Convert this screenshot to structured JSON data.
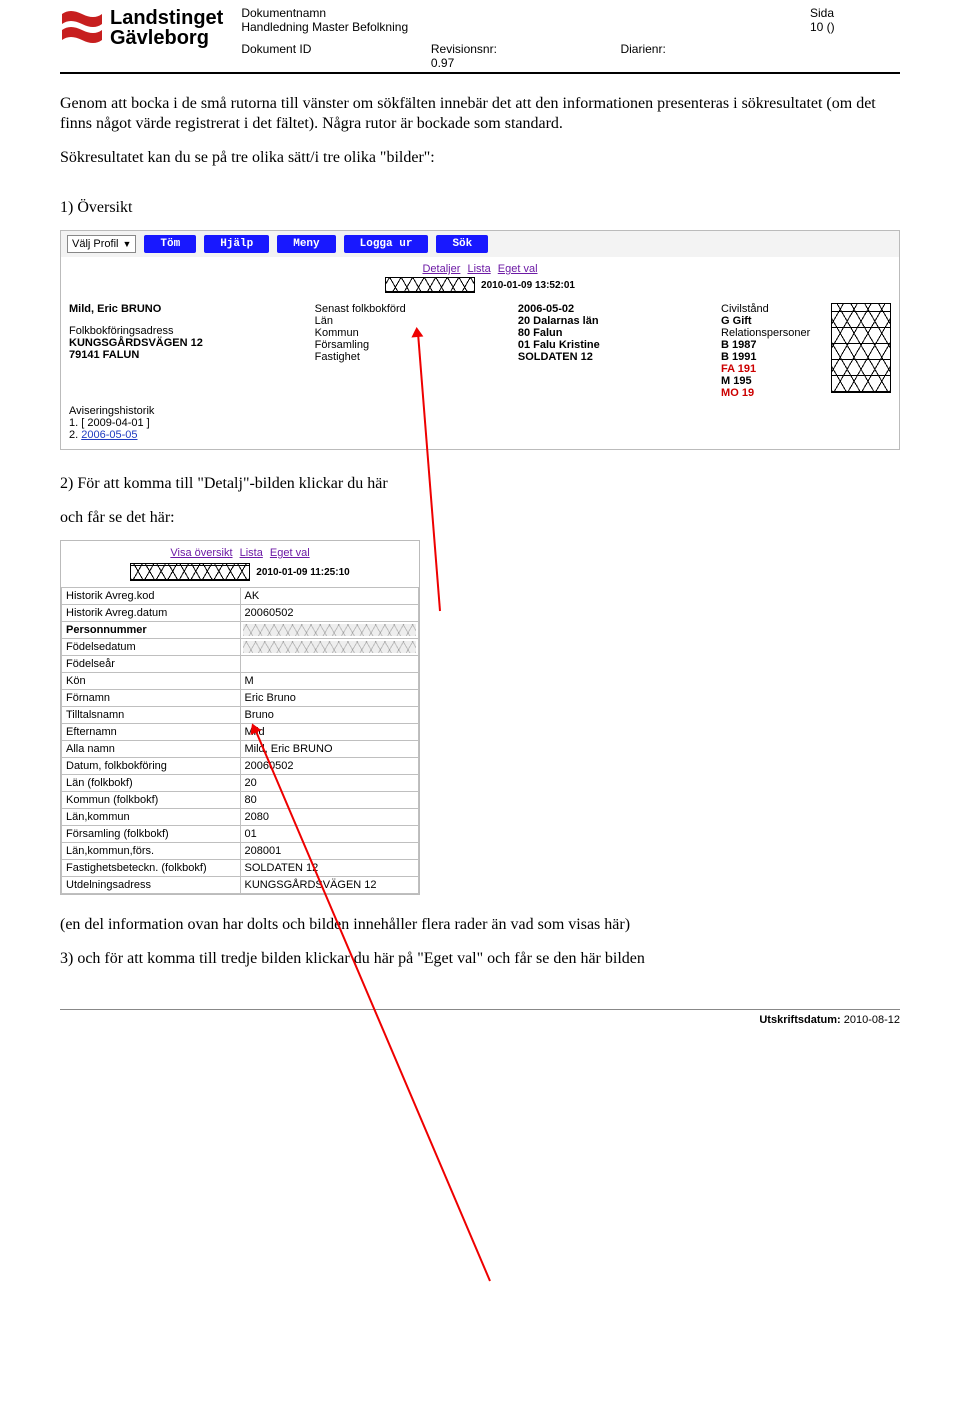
{
  "header": {
    "logo1": "Landstinget",
    "logo2": "Gävleborg",
    "row1": {
      "c1l": "Dokumentnamn",
      "c4l": "Sida"
    },
    "row1v": {
      "c1": "Handledning Master Befolkning",
      "c4": "10 ()"
    },
    "row2": {
      "c1l": "Dokument ID",
      "c2l": "Revisionsnr:",
      "c3l": "Diarienr:"
    },
    "row2v": {
      "c2": "0.97"
    }
  },
  "body": {
    "p1": "Genom att bocka i de små rutorna till vänster om sökfälten innebär det att den informationen presenteras i sökresultatet (om det finns något värde registrerat i det fältet).",
    "p2": "Några rutor är bockade som standard.",
    "p3": "Sökresultatet kan du se på tre olika sätt/i tre olika \"bilder\":",
    "h1": "1) Översikt",
    "p4": "2) För att komma till \"Detalj\"-bilden klickar du här",
    "p5": "och får se det här:",
    "p6": "(en del information ovan har dolts och bilden innehåller flera rader än vad som visas här)",
    "p7": "3) och för att komma till tredje bilden klickar du här på \"Eget val\" och får se den här bilden"
  },
  "shot1": {
    "profile": "Välj Profil",
    "buttons": [
      "Töm",
      "Hjälp",
      "Meny",
      "Logga ur",
      "Sök"
    ],
    "sublinks": [
      "Detaljer",
      "Lista",
      "Eget val"
    ],
    "timestamp": "2010-01-09 13:52:01",
    "col2labels": [
      "Senast folkbokförd",
      "Län",
      "Kommun",
      "Församling",
      "Fastighet"
    ],
    "col3values": [
      "2006-05-02",
      "20 Dalarnas län",
      "80 Falun",
      "01 Falu Kristine",
      "SOLDATEN 12"
    ],
    "col4label": "Civilstånd",
    "col4value": "G Gift",
    "col4label2": "Relationspersoner",
    "rel": [
      "B 1987",
      "B 1991",
      "FA 191",
      "M 195",
      "MO 19"
    ],
    "name": "Mild, Eric BRUNO",
    "addr_label": "Folkbokföringsadress",
    "addr1": "KUNGSGÅRDSVÄGEN 12",
    "addr2": "79141 FALUN",
    "avis_label": "Aviseringshistorik",
    "avis1": "1. [ 2009-04-01 ]",
    "avis2_pre": "2. ",
    "avis2_link": "2006-05-05"
  },
  "shot2": {
    "sublinks": [
      "Visa översikt",
      "Lista",
      "Eget val"
    ],
    "timestamp": "2010-01-09 11:25:10",
    "rows": [
      {
        "label": "Historik Avreg.kod",
        "value": "AK"
      },
      {
        "label": "Historik Avreg.datum",
        "value": "20060502"
      },
      {
        "label": "Personnummer",
        "value": "",
        "strong": true,
        "blur": true
      },
      {
        "label": "Födelsedatum",
        "value": "",
        "blur": true
      },
      {
        "label": "Födelseår",
        "value": ""
      },
      {
        "label": "Kön",
        "value": "M"
      },
      {
        "label": "Förnamn",
        "value": "Eric Bruno"
      },
      {
        "label": "Tilltalsnamn",
        "value": "Bruno"
      },
      {
        "label": "Efternamn",
        "value": "Mild"
      },
      {
        "label": "Alla namn",
        "value": "Mild, Eric BRUNO"
      },
      {
        "label": "Datum, folkbokföring",
        "value": "20060502"
      },
      {
        "label": "Län (folkbokf)",
        "value": "20"
      },
      {
        "label": "Kommun (folkbokf)",
        "value": "80"
      },
      {
        "label": "Län,kommun",
        "value": "2080"
      },
      {
        "label": "Församling (folkbokf)",
        "value": "01"
      },
      {
        "label": "Län,kommun,förs.",
        "value": "208001"
      },
      {
        "label": "Fastighetsbeteckn. (folkbokf)",
        "value": "SOLDATEN 12"
      },
      {
        "label": "Utdelningsadress",
        "value": "KUNGSGÅRDSVÄGEN 12"
      }
    ]
  },
  "footer": {
    "label": "Utskriftsdatum:",
    "value": "2010-08-12"
  }
}
